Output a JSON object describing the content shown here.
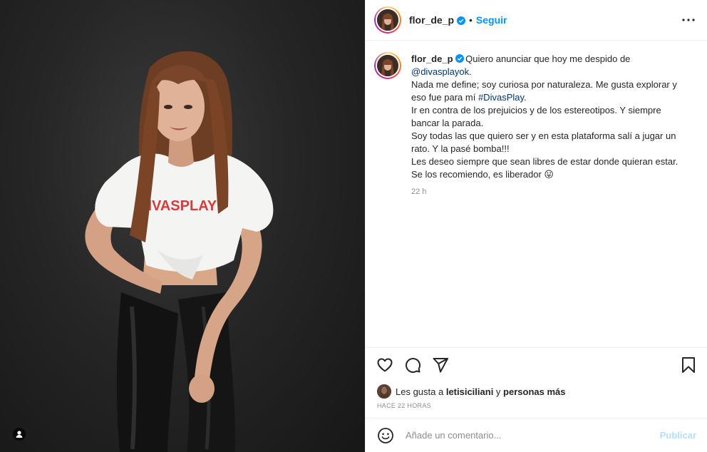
{
  "post": {
    "author": "flor_de_p",
    "follow_label": "Seguir",
    "separator": "•",
    "image_print": "DIVASPLAY",
    "icons": {
      "verified": "verified-badge-icon",
      "more": "more-options-icon",
      "like": "heart-icon",
      "comment": "comment-icon",
      "share": "share-icon",
      "save": "bookmark-icon",
      "emoji": "emoji-icon",
      "tag": "user-tag-icon"
    },
    "colors": {
      "accent": "#0095f6",
      "link": "#00376b",
      "muted": "#8e8e8e",
      "publish_disabled": "#b2dffc"
    }
  },
  "caption": {
    "user": "flor_de_p",
    "lines": [
      "Quiero anunciar que hoy me despido de",
      "@divasplayok.",
      "Nada me define; soy curiosa por naturaleza. Me gusta explorar y",
      "eso fue para mí #DivasPlay.",
      "Ir en contra de los prejuicios y de los estereotipos. Y siempre",
      "bancar la parada.",
      "Soy todas las que quiero ser y en esta plataforma salí a jugar un",
      "rato. Y la pasé bomba!!!",
      "Les deseo siempre que sean libres de estar donde quieran estar.",
      "Se los recomiendo, es liberador 😛"
    ],
    "time_ago": "22 h"
  },
  "likes": {
    "prefix": "Les gusta a ",
    "user": "letisiciliani",
    "middle": " y ",
    "rest": "personas más"
  },
  "posted_ago": "HACE 22 HORAS",
  "comment_box": {
    "placeholder": "Añade un comentario...",
    "publish_label": "Publicar"
  }
}
